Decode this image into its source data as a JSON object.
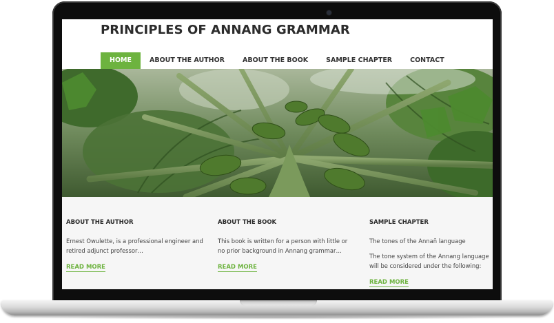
{
  "site": {
    "title": "PRINCIPLES OF ANNANG GRAMMAR"
  },
  "nav": {
    "items": [
      {
        "label": "HOME",
        "active": true
      },
      {
        "label": "ABOUT THE AUTHOR",
        "active": false
      },
      {
        "label": "ABOUT THE BOOK",
        "active": false
      },
      {
        "label": "SAMPLE CHAPTER",
        "active": false
      },
      {
        "label": "CONTACT",
        "active": false
      }
    ]
  },
  "colors": {
    "accent": "#6db33f",
    "content_background": "#f6f6f6",
    "laptop_bezel": "#0d0d0d"
  },
  "columns": [
    {
      "heading": "ABOUT THE AUTHOR",
      "paragraphs": [
        "Ernest Owulette, is a professional engineer and retired adjunct professor…"
      ],
      "link": "READ MORE"
    },
    {
      "heading": "ABOUT THE BOOK",
      "paragraphs": [
        "This book is written for a person with little or no prior background in Annang grammar…"
      ],
      "link": "READ MORE"
    },
    {
      "heading": "SAMPLE CHAPTER",
      "paragraphs": [
        "The tones of the Annañ language",
        "The tone system of the Annang language will be considered under the following:"
      ],
      "link": "READ MORE"
    }
  ]
}
